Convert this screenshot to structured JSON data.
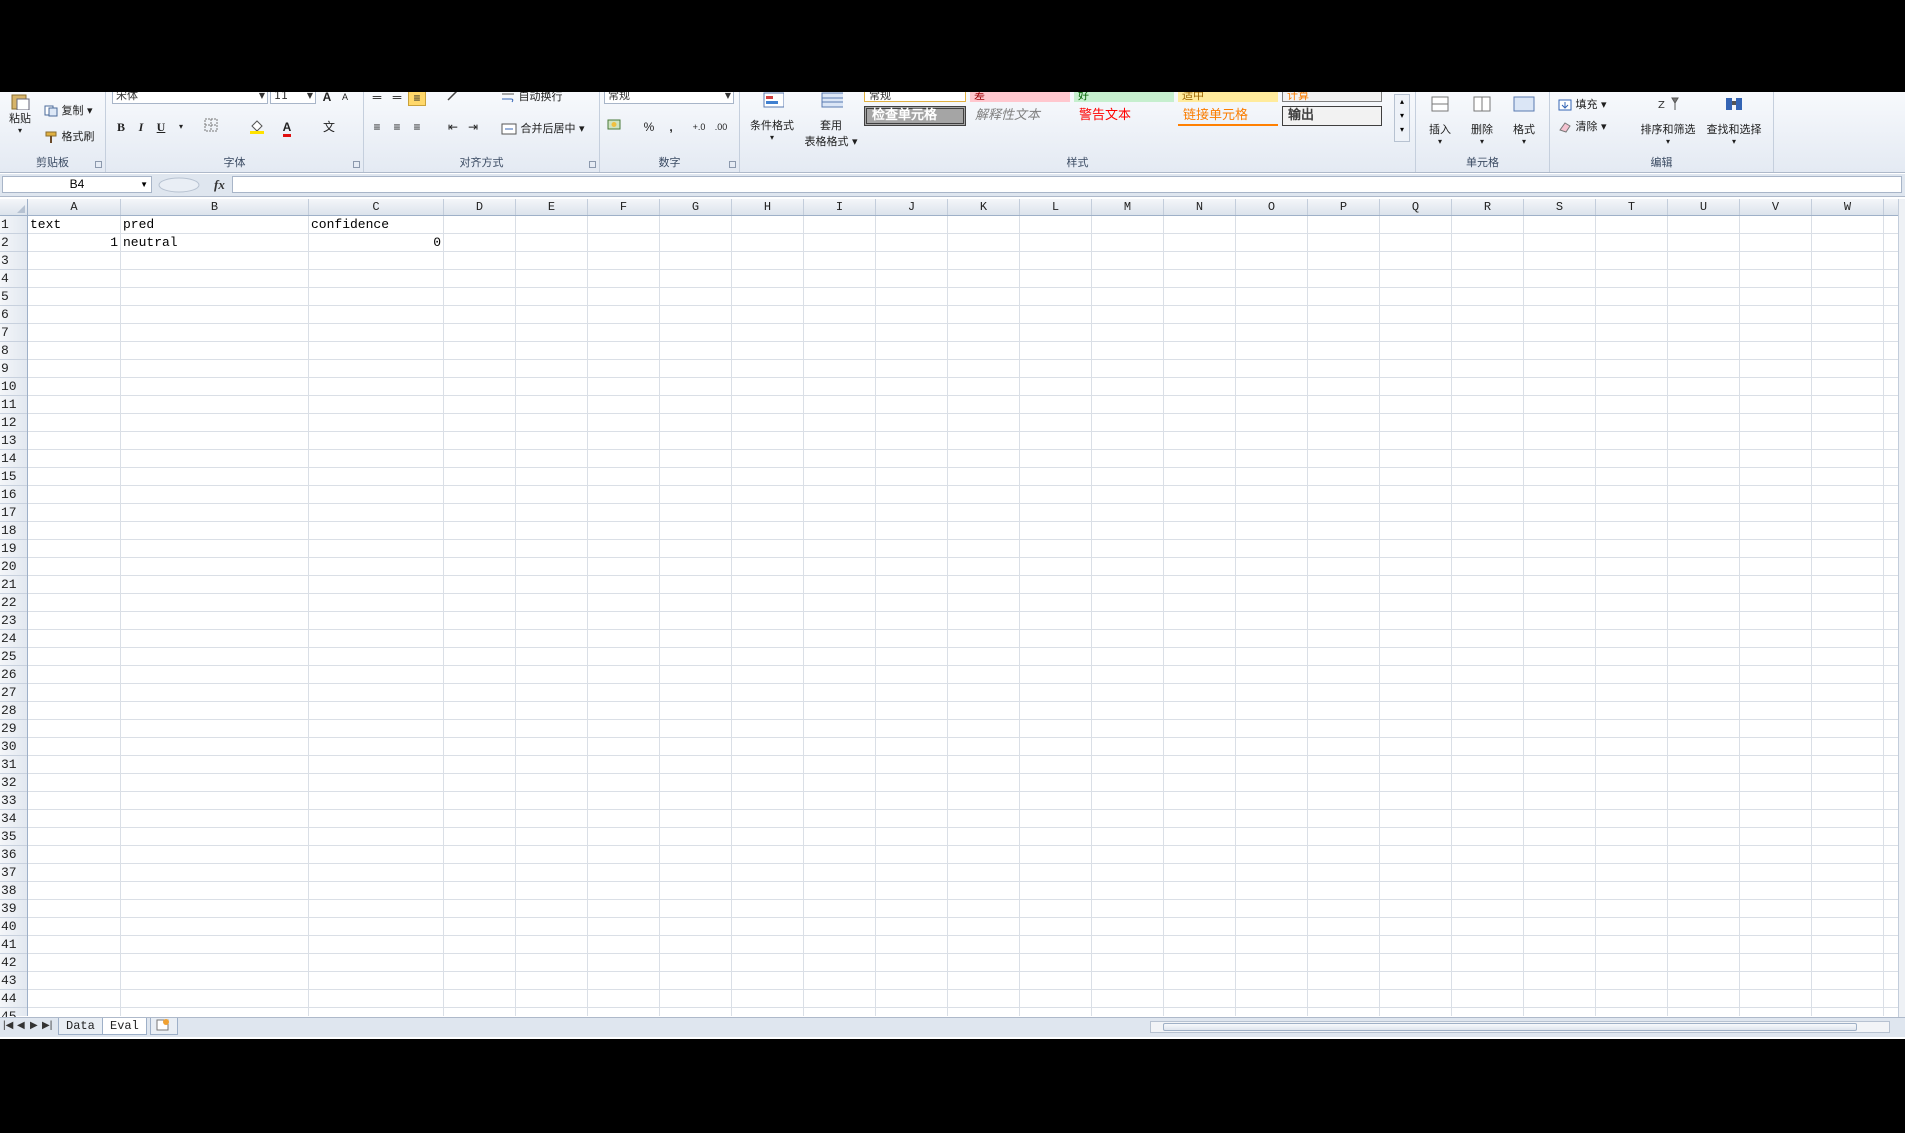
{
  "ribbon": {
    "clipboard": {
      "paste": "粘贴",
      "copy": "复制",
      "format_painter": "格式刷",
      "label": "剪贴板"
    },
    "font": {
      "font_name": "宋体",
      "font_size": "11",
      "bold": "B",
      "italic": "I",
      "underline": "U",
      "label": "字体"
    },
    "alignment": {
      "wrap_text": "自动换行",
      "merge_center": "合并后居中",
      "label": "对齐方式"
    },
    "number": {
      "format": "常规",
      "percent": "%",
      "comma": ",",
      "label": "数字"
    },
    "styles": {
      "conditional_format": "条件格式",
      "table_format_line1": "套用",
      "table_format_line2": "表格格式",
      "row1": [
        "常规",
        "差",
        "好",
        "适中",
        "计算"
      ],
      "row2": [
        "检查单元格",
        "解释性文本",
        "警告文本",
        "链接单元格",
        "输出"
      ],
      "label": "样式"
    },
    "cells": {
      "insert": "插入",
      "delete": "删除",
      "format": "格式",
      "label": "单元格"
    },
    "editing": {
      "fill": "填充",
      "clear": "清除",
      "sort_filter": "排序和筛选",
      "find_select": "查找和选择",
      "label": "编辑"
    }
  },
  "formula_bar": {
    "name_box": "B4",
    "fx": "fx",
    "formula": ""
  },
  "columns": [
    "A",
    "B",
    "C",
    "D",
    "E",
    "F",
    "G",
    "H",
    "I",
    "J",
    "K",
    "L",
    "M",
    "N",
    "O",
    "P",
    "Q",
    "R",
    "S",
    "T",
    "U",
    "V",
    "W"
  ],
  "rows_visible": 45,
  "cells": {
    "A1": "text",
    "B1": "pred",
    "C1": "confidence",
    "A2": "1",
    "B2": "neutral",
    "C2": "0"
  },
  "sheets": {
    "tabs": [
      "Data",
      "Eval"
    ],
    "active": "Eval"
  },
  "colors": {
    "ribbon_bg": "#e4eaf3",
    "grid_line": "#dadfe6",
    "header_bg": "#dce3ec"
  }
}
